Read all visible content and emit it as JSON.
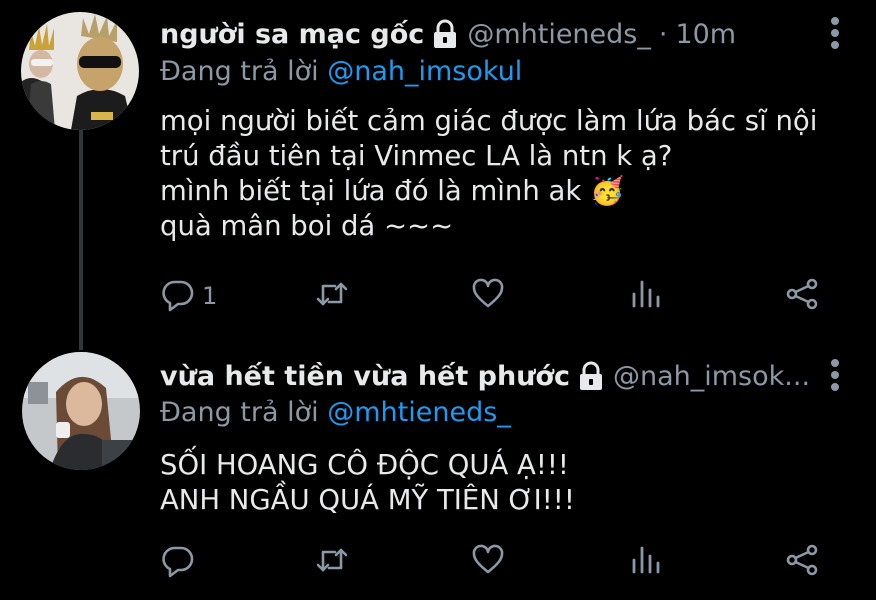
{
  "tweets": [
    {
      "name": "người sa mạc gốc",
      "handle": "@mhtieneds_",
      "time": "10m",
      "reply_prefix": "Đang trả lời ",
      "reply_mention": "@nah_imsokul",
      "lines": [
        "mọi người biết cảm giác được làm lứa bác sĩ nội",
        "trú đầu tiên tại Vinmec LA là ntn k ạ?",
        "mình biết tại lứa đó là mình ak",
        "quà mân boi dá ~~~"
      ],
      "emoji": "🥳",
      "reply_count": "1"
    },
    {
      "name": "vừa hết tiền vừa hết phước",
      "handle": "@nah_imsok...",
      "reply_prefix": "Đang trả lời ",
      "reply_mention": "@mhtieneds_",
      "lines": [
        "SỐI HOANG CÔ ĐỘC QUÁ Ạ!!!",
        "ANH NGẦU QUÁ MỸ TIÊN ƠI!!!"
      ]
    }
  ],
  "icons": {
    "lock": "lock-icon",
    "more": "more-vertical-icon",
    "reply": "reply-icon",
    "retweet": "retweet-icon",
    "like": "heart-icon",
    "analytics": "analytics-icon",
    "share": "share-icon"
  },
  "colors": {
    "background": "#000000",
    "text": "#e7e9ea",
    "muted": "#8b98a5",
    "link": "#1d9bf0"
  }
}
